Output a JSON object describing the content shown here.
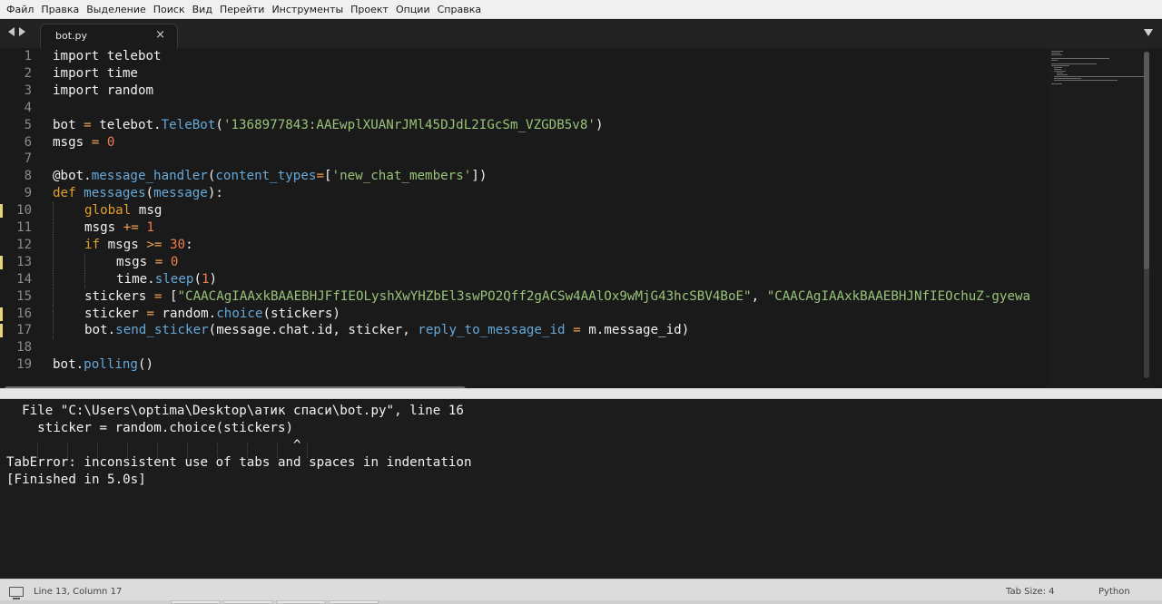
{
  "menu": [
    "Файл",
    "Правка",
    "Выделение",
    "Поиск",
    "Вид",
    "Перейти",
    "Инструменты",
    "Проект",
    "Опции",
    "Справка"
  ],
  "tab": {
    "label": "bot.py",
    "close": "×"
  },
  "code_lines": [
    {
      "n": "1",
      "mod": false,
      "indent": 0,
      "tokens": [
        {
          "t": "import",
          "c": "c-kw"
        },
        {
          "t": " telebot",
          "c": "c-plain"
        }
      ]
    },
    {
      "n": "2",
      "mod": false,
      "indent": 0,
      "tokens": [
        {
          "t": "import",
          "c": "c-kw"
        },
        {
          "t": " time",
          "c": "c-plain"
        }
      ]
    },
    {
      "n": "3",
      "mod": false,
      "indent": 0,
      "tokens": [
        {
          "t": "import",
          "c": "c-kw"
        },
        {
          "t": " random",
          "c": "c-plain"
        }
      ]
    },
    {
      "n": "4",
      "mod": false,
      "indent": 0,
      "tokens": []
    },
    {
      "n": "5",
      "mod": false,
      "indent": 0,
      "tokens": [
        {
          "t": "bot ",
          "c": "c-plain"
        },
        {
          "t": "=",
          "c": "c-op"
        },
        {
          "t": " telebot.",
          "c": "c-plain"
        },
        {
          "t": "TeleBot",
          "c": "c-fn"
        },
        {
          "t": "(",
          "c": "c-plain"
        },
        {
          "t": "'1368977843:AAEwplXUANrJMl45DJdL2IGcSm_VZGDB5v8'",
          "c": "c-str"
        },
        {
          "t": ")",
          "c": "c-plain"
        }
      ]
    },
    {
      "n": "6",
      "mod": false,
      "indent": 0,
      "tokens": [
        {
          "t": "msgs ",
          "c": "c-plain"
        },
        {
          "t": "=",
          "c": "c-op"
        },
        {
          "t": " ",
          "c": "c-plain"
        },
        {
          "t": "0",
          "c": "c-num"
        }
      ]
    },
    {
      "n": "7",
      "mod": false,
      "indent": 0,
      "tokens": []
    },
    {
      "n": "8",
      "mod": false,
      "indent": 0,
      "tokens": [
        {
          "t": "@bot.",
          "c": "c-dec"
        },
        {
          "t": "message_handler",
          "c": "c-fn"
        },
        {
          "t": "(",
          "c": "c-plain"
        },
        {
          "t": "content_types",
          "c": "c-param"
        },
        {
          "t": "=",
          "c": "c-op"
        },
        {
          "t": "[",
          "c": "c-plain"
        },
        {
          "t": "'new_chat_members'",
          "c": "c-str"
        },
        {
          "t": "])",
          "c": "c-plain"
        }
      ]
    },
    {
      "n": "9",
      "mod": false,
      "indent": 0,
      "tokens": [
        {
          "t": "def",
          "c": "c-kwpy"
        },
        {
          "t": " ",
          "c": "c-plain"
        },
        {
          "t": "messages",
          "c": "c-fn"
        },
        {
          "t": "(",
          "c": "c-plain"
        },
        {
          "t": "message",
          "c": "c-param"
        },
        {
          "t": "):",
          "c": "c-plain"
        }
      ]
    },
    {
      "n": "10",
      "mod": true,
      "indent": 1,
      "tokens": [
        {
          "t": "global",
          "c": "c-kwpy"
        },
        {
          "t": " msg",
          "c": "c-plain"
        }
      ]
    },
    {
      "n": "11",
      "mod": false,
      "indent": 1,
      "tokens": [
        {
          "t": "msgs ",
          "c": "c-plain"
        },
        {
          "t": "+=",
          "c": "c-op"
        },
        {
          "t": " ",
          "c": "c-plain"
        },
        {
          "t": "1",
          "c": "c-num"
        }
      ]
    },
    {
      "n": "12",
      "mod": false,
      "indent": 1,
      "tokens": [
        {
          "t": "if",
          "c": "c-kwpy"
        },
        {
          "t": " msgs ",
          "c": "c-plain"
        },
        {
          "t": ">=",
          "c": "c-op"
        },
        {
          "t": " ",
          "c": "c-plain"
        },
        {
          "t": "30",
          "c": "c-num"
        },
        {
          "t": ":",
          "c": "c-plain"
        }
      ]
    },
    {
      "n": "13",
      "mod": true,
      "indent": 2,
      "tokens": [
        {
          "t": "msgs ",
          "c": "c-plain"
        },
        {
          "t": "=",
          "c": "c-op"
        },
        {
          "t": " ",
          "c": "c-plain"
        },
        {
          "t": "0",
          "c": "c-num"
        }
      ]
    },
    {
      "n": "14",
      "mod": false,
      "indent": 2,
      "tokens": [
        {
          "t": "time.",
          "c": "c-plain"
        },
        {
          "t": "sleep",
          "c": "c-fn"
        },
        {
          "t": "(",
          "c": "c-plain"
        },
        {
          "t": "1",
          "c": "c-num"
        },
        {
          "t": ")",
          "c": "c-plain"
        }
      ]
    },
    {
      "n": "15",
      "mod": false,
      "indent": 1,
      "tokens": [
        {
          "t": "stickers ",
          "c": "c-plain"
        },
        {
          "t": "=",
          "c": "c-op"
        },
        {
          "t": " [",
          "c": "c-plain"
        },
        {
          "t": "\"CAACAgIAAxkBAAEBHJFfIEOLyshXwYHZbEl3swPO2Qff2gACSw4AAlOx9wMjG43hcSBV4BoE\"",
          "c": "c-str"
        },
        {
          "t": ", ",
          "c": "c-plain"
        },
        {
          "t": "\"CAACAgIAAxkBAAEBHJNfIEOchuZ-gyewa",
          "c": "c-str"
        }
      ]
    },
    {
      "n": "16",
      "mod": true,
      "indent": 1,
      "tokens": [
        {
          "t": "sticker ",
          "c": "c-plain"
        },
        {
          "t": "=",
          "c": "c-op"
        },
        {
          "t": " random.",
          "c": "c-plain"
        },
        {
          "t": "choice",
          "c": "c-fn"
        },
        {
          "t": "(stickers)",
          "c": "c-plain"
        }
      ]
    },
    {
      "n": "17",
      "mod": true,
      "indent": 1,
      "tokens": [
        {
          "t": "bot.",
          "c": "c-plain"
        },
        {
          "t": "send_sticker",
          "c": "c-fn"
        },
        {
          "t": "(message.chat.id, sticker, ",
          "c": "c-plain"
        },
        {
          "t": "reply_to_message_id",
          "c": "c-param"
        },
        {
          "t": " ",
          "c": "c-plain"
        },
        {
          "t": "=",
          "c": "c-op"
        },
        {
          "t": " m.message_id)",
          "c": "c-plain"
        }
      ]
    },
    {
      "n": "18",
      "mod": false,
      "indent": 0,
      "tokens": []
    },
    {
      "n": "19",
      "mod": false,
      "indent": 0,
      "tokens": [
        {
          "t": "bot.",
          "c": "c-plain"
        },
        {
          "t": "polling",
          "c": "c-fn"
        },
        {
          "t": "()",
          "c": "c-plain"
        }
      ]
    }
  ],
  "output": {
    "lines": [
      "  File \"C:\\Users\\optima\\Desktop\\атик спаси\\bot.py\", line 16",
      "    sticker = random.choice(stickers)",
      "                                     ^",
      "TabError: inconsistent use of tabs and spaces in indentation",
      "[Finished in 5.0s]"
    ]
  },
  "status": {
    "position": "Line 13, Column 17",
    "tab_size": "Tab Size: 4",
    "syntax": "Python"
  }
}
